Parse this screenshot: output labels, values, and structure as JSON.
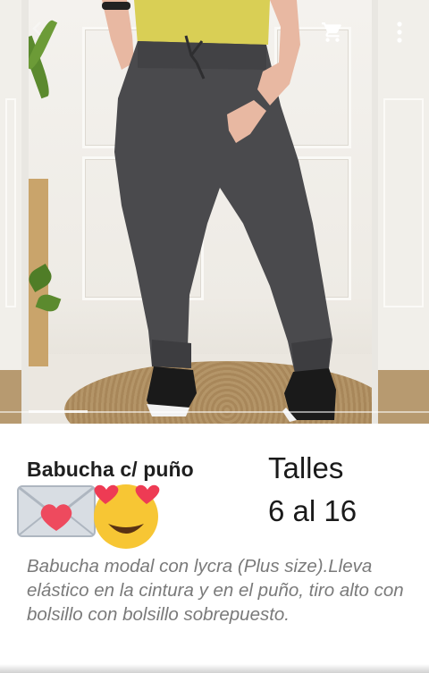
{
  "header": {
    "icons": [
      "back-arrow-icon",
      "cart-icon",
      "more-vert-icon"
    ]
  },
  "gallery": {
    "image_subject": "product-photo",
    "colors": {
      "pants": "#4a4a4d",
      "top": "#d9cf55",
      "skin": "#e8b8a2",
      "shoe": "#1a1a1a"
    }
  },
  "product": {
    "title": "Babucha c/ puño",
    "sizes_label": "Talles",
    "sizes_range": "6 al 16",
    "emojis": [
      "love-letter-emoji",
      "heart-eyes-emoji"
    ],
    "description": "Babucha modal con lycra (Plus size).Lleva elástico en la cintura y en el puño,  tiro alto con bolsillo con bolsillo sobrepuesto."
  },
  "colors": {
    "title_text": "#1f1f1f",
    "description_text": "#7a7a7a",
    "background": "#ffffff"
  }
}
